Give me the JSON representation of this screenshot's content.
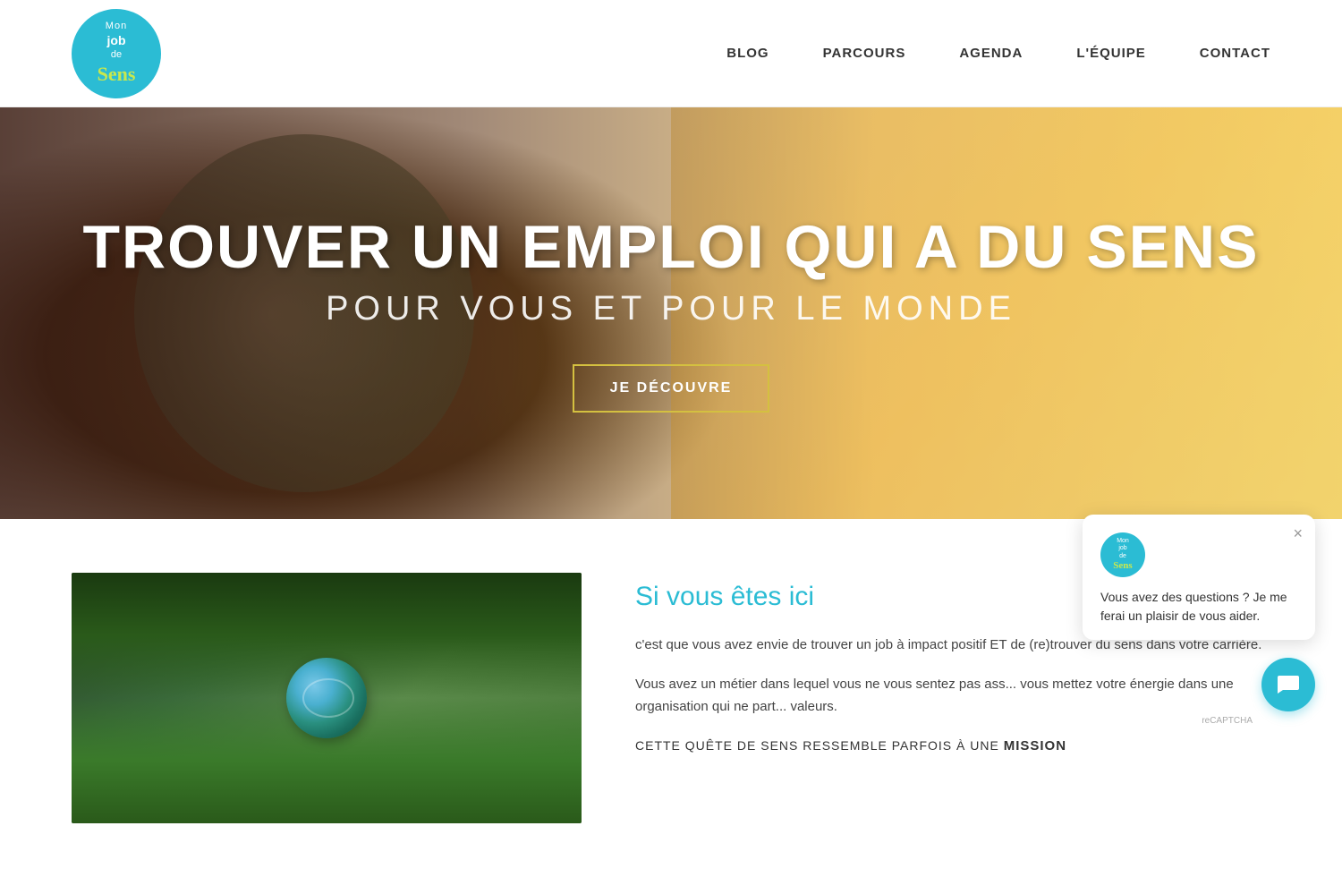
{
  "header": {
    "logo": {
      "mon": "Mon",
      "job": "job",
      "de": "de",
      "sens": "Sens"
    },
    "nav": {
      "blog": "BLOG",
      "parcours": "PARCOURS",
      "agenda": "AGENDA",
      "lequipe": "L'ÉQUIPE",
      "contact": "CONTACT"
    }
  },
  "hero": {
    "title": "TROUVER UN EMPLOI QUI A DU SENS",
    "subtitle": "POUR VOUS ET POUR LE MONDE",
    "button_label": "JE DÉCOUVRE"
  },
  "content": {
    "heading": "Si vous êtes ici",
    "paragraph1": "c'est que vous avez envie de trouver un job à impact positif ET de (re)trouver du sens dans votre carrière.",
    "paragraph2": "Vous avez un métier dans lequel vous ne vous sentez pas ass... vous mettez votre énergie dans une organisation qui ne part... valeurs.",
    "mission_prefix": "CETTE QUÊTE DE SENS RESSEMBLE PARFOIS À UNE",
    "mission_bold": "MISSION"
  },
  "chat": {
    "popup_message": "Vous avez des questions ? Je me ferai un plaisir de vous aider.",
    "close_label": "×",
    "avatar_mon": "Mon",
    "avatar_job": "job",
    "avatar_de": "de",
    "avatar_sens": "Sens"
  },
  "recaptcha": "reCAPTCHA"
}
